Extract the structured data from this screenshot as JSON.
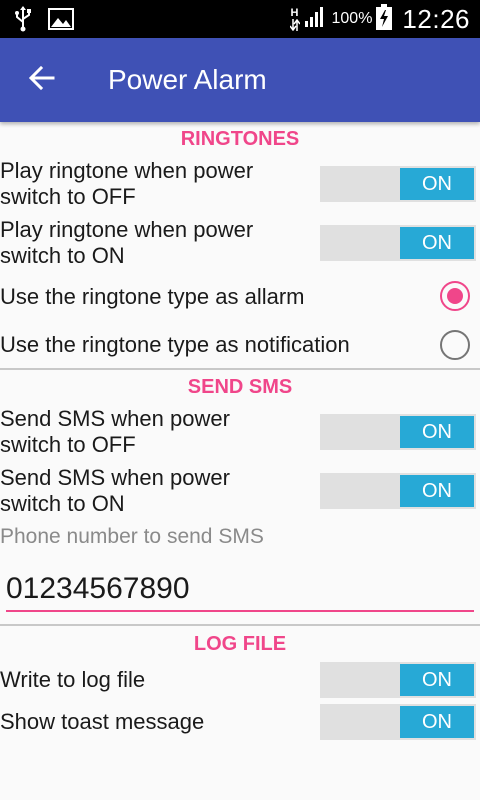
{
  "statusbar": {
    "network_h": "H",
    "battery_pct": "100%",
    "time": "12:26"
  },
  "appbar": {
    "title": "Power Alarm",
    "color": "#3f51b5"
  },
  "accent": "#f0468a",
  "toggle_color": "#27a9d6",
  "sections": {
    "ringtones": {
      "header": "RINGTONES",
      "play_off": {
        "label_line1": "Play ringtone when power",
        "label_line2": "switch to OFF",
        "state": "ON"
      },
      "play_on": {
        "label_line1": "Play ringtone when power",
        "label_line2": "switch to ON",
        "state": "ON"
      },
      "radio_alarm": {
        "label": "Use the ringtone type as allarm",
        "checked": true
      },
      "radio_notification": {
        "label": "Use the ringtone type as notification",
        "checked": false
      }
    },
    "sms": {
      "header": "SEND SMS",
      "send_off": {
        "label_line1": "Send SMS when power",
        "label_line2": "switch to OFF",
        "state": "ON"
      },
      "send_on": {
        "label_line1": "Send SMS when power",
        "label_line2": "switch to ON",
        "state": "ON"
      },
      "phone_label": "Phone number to send SMS",
      "phone_value": "01234567890"
    },
    "log": {
      "header": "LOG FILE",
      "write_log": {
        "label": "Write to log file",
        "state": "ON"
      },
      "show_toast": {
        "label": "Show toast message",
        "state": "ON"
      }
    }
  }
}
